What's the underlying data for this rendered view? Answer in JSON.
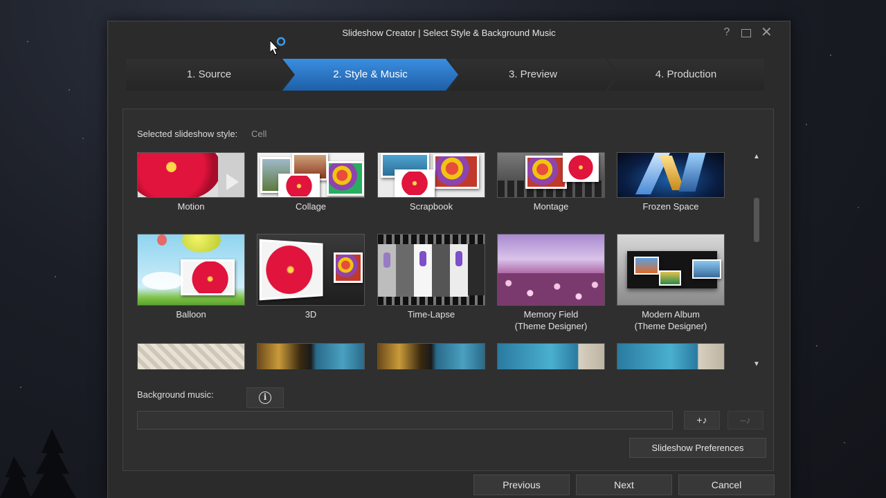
{
  "window": {
    "title": "Slideshow Creator | Select Style & Background Music",
    "help_icon": "?",
    "close_icon": "✕"
  },
  "steps": [
    {
      "label": "1. Source",
      "active": false
    },
    {
      "label": "2. Style & Music",
      "active": true
    },
    {
      "label": "3. Preview",
      "active": false
    },
    {
      "label": "4. Production",
      "active": false
    }
  ],
  "style": {
    "selected_label": "Selected slideshow style:",
    "selected_value": "Cell"
  },
  "styles": [
    {
      "label": "Motion"
    },
    {
      "label": "Collage"
    },
    {
      "label": "Scrapbook"
    },
    {
      "label": "Montage"
    },
    {
      "label": "Frozen Space"
    },
    {
      "label": "Balloon"
    },
    {
      "label": "3D"
    },
    {
      "label": "Time-Lapse"
    },
    {
      "label": "Memory Field",
      "sublabel": "(Theme Designer)"
    },
    {
      "label": "Modern Album",
      "sublabel": "(Theme Designer)"
    }
  ],
  "scroll": {
    "up": "▲",
    "down": "▼"
  },
  "music": {
    "label": "Background music:",
    "info_icon": "i",
    "field_value": "",
    "add_icon": "+♪",
    "remove_icon": "–♪"
  },
  "buttons": {
    "preferences": "Slideshow Preferences",
    "previous": "Previous",
    "next": "Next",
    "cancel": "Cancel"
  },
  "colors": {
    "active_step": "#2a79c8",
    "dialog_bg": "#2b2b2b",
    "panel_bg": "#2f2f2f"
  }
}
